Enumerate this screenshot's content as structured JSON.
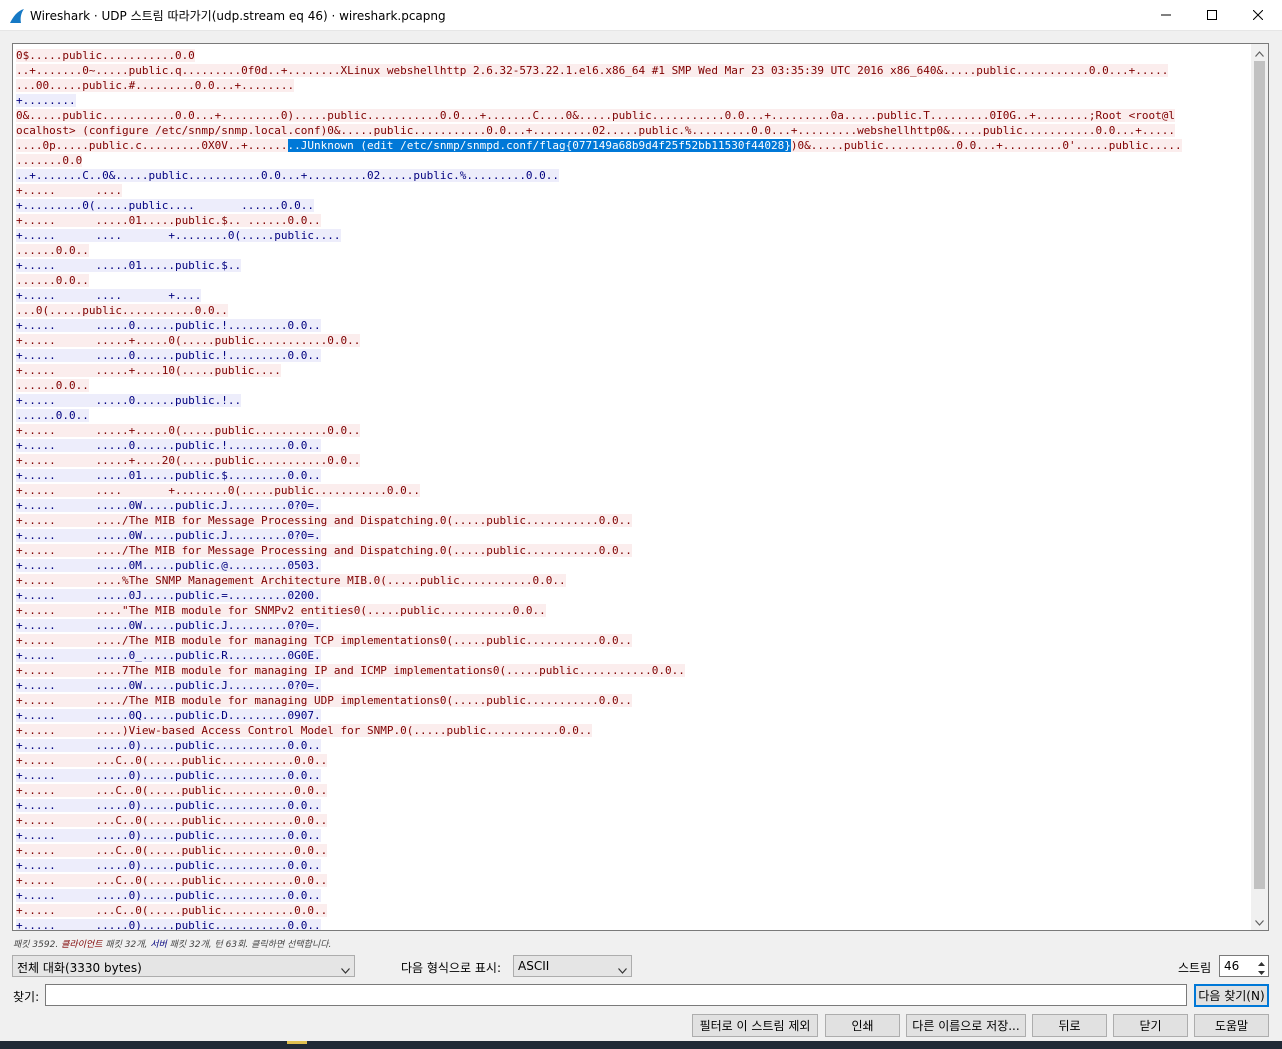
{
  "window": {
    "title": "Wireshark · UDP 스트림 따라가기(udp.stream eq 46) · wireshark.pcapng"
  },
  "stream": {
    "lines": [
      [
        [
          "c",
          "0$.....public...........0.0"
        ]
      ],
      [
        [
          "c",
          "..+.......0~.....public.q.........0f0d..+........XLinux webshellhttp 2.6.32-573.22.1.el6.x86_64 #1 SMP Wed Mar 23 03:35:39 UTC 2016 x86_640&.....public...........0.0...+....."
        ]
      ],
      [
        [
          "c",
          "...00.....public.#.........0.0...+........"
        ]
      ],
      [
        [
          "s",
          "+........"
        ]
      ],
      [
        [
          "c",
          "0&.....public...........0.0...+.........0).....public...........0.0...+.......C....0&.....public...........0.0...+.........0a.....public.T.........0I0G..+........;Root <root@l"
        ]
      ],
      [
        [
          "c",
          "ocalhost> (configure /etc/snmp/snmp.local.conf)0&.....public...........0.0...+.........02.....public.%.........0.0...+.........webshellhttp0&.....public...........0.0...+....."
        ]
      ],
      [
        [
          "c",
          "....0p.....public.c.........0X0V..+......"
        ],
        [
          "sel",
          "..JUnknown (edit /etc/snmp/snmpd.conf/flag{077149a68b9d4f25f52bb11530f44028}"
        ],
        [
          "c",
          ")0&.....public...........0.0...+.........0'.....public....."
        ]
      ],
      [
        [
          "c",
          ".......0.0"
        ]
      ],
      [
        [
          "s",
          "..+.......C..0&.....public...........0.0...+.........02.....public.%.........0.0.."
        ]
      ],
      [
        [
          "c",
          "+.....      ...."
        ]
      ],
      [
        [
          "s",
          "+.........0(.....public....       ......0.0.."
        ]
      ],
      [
        [
          "c",
          "+.....      .....01.....public.$.. ......0.0.."
        ]
      ],
      [
        [
          "s",
          "+.....      ....       +........0(.....public...."
        ]
      ],
      [
        [
          "c",
          "......0.0.."
        ]
      ],
      [
        [
          "s",
          "+.....      .....01.....public.$.."
        ]
      ],
      [
        [
          "c",
          "......0.0.."
        ]
      ],
      [
        [
          "s",
          "+.....      ....       +...."
        ]
      ],
      [
        [
          "c",
          "...0(.....public...........0.0.."
        ]
      ],
      [
        [
          "s",
          "+.....      .....0......public.!.........0.0.."
        ]
      ],
      [
        [
          "c",
          "+.....      .....+.....0(.....public...........0.0.."
        ]
      ],
      [
        [
          "s",
          "+.....      .....0......public.!.........0.0.."
        ]
      ],
      [
        [
          "c",
          "+.....      .....+....10(.....public...."
        ]
      ],
      [
        [
          "c",
          "......0.0.."
        ]
      ],
      [
        [
          "s",
          "+.....      .....0......public.!.."
        ]
      ],
      [
        [
          "s",
          "......0.0.."
        ]
      ],
      [
        [
          "c",
          "+.....      .....+.....0(.....public...........0.0.."
        ]
      ],
      [
        [
          "s",
          "+.....      .....0......public.!.........0.0.."
        ]
      ],
      [
        [
          "c",
          "+.....      .....+....20(.....public...........0.0.."
        ]
      ],
      [
        [
          "s",
          "+.....      .....01.....public.$.........0.0.."
        ]
      ],
      [
        [
          "c",
          "+.....      ....       +........0(.....public...........0.0.."
        ]
      ],
      [
        [
          "s",
          "+.....      .....0W.....public.J.........0?0=."
        ]
      ],
      [
        [
          "c",
          "+.....      ..../The MIB for Message Processing and Dispatching.0(.....public...........0.0.."
        ]
      ],
      [
        [
          "s",
          "+.....      .....0W.....public.J.........0?0=."
        ]
      ],
      [
        [
          "c",
          "+.....      ..../The MIB for Message Processing and Dispatching.0(.....public...........0.0.."
        ]
      ],
      [
        [
          "s",
          "+.....      .....0M.....public.@.........0503."
        ]
      ],
      [
        [
          "c",
          "+.....      ....%The SNMP Management Architecture MIB.0(.....public...........0.0.."
        ]
      ],
      [
        [
          "s",
          "+.....      .....0J.....public.=.........0200."
        ]
      ],
      [
        [
          "c",
          "+.....      ....\"The MIB module for SNMPv2 entities0(.....public...........0.0.."
        ]
      ],
      [
        [
          "s",
          "+.....      .....0W.....public.J.........0?0=."
        ]
      ],
      [
        [
          "c",
          "+.....      ..../The MIB module for managing TCP implementations0(.....public...........0.0.."
        ]
      ],
      [
        [
          "s",
          "+.....      .....0_.....public.R.........0G0E."
        ]
      ],
      [
        [
          "c",
          "+.....      ....7The MIB module for managing IP and ICMP implementations0(.....public...........0.0.."
        ]
      ],
      [
        [
          "s",
          "+.....      .....0W.....public.J.........0?0=."
        ]
      ],
      [
        [
          "c",
          "+.....      ..../The MIB module for managing UDP implementations0(.....public...........0.0.."
        ]
      ],
      [
        [
          "s",
          "+.....      .....0Q.....public.D.........0907."
        ]
      ],
      [
        [
          "c",
          "+.....      ....)View-based Access Control Model for SNMP.0(.....public...........0.0.."
        ]
      ],
      [
        [
          "s",
          "+.....      .....0).....public...........0.0.."
        ]
      ],
      [
        [
          "c",
          "+.....      ...C..0(.....public...........0.0.."
        ]
      ],
      [
        [
          "s",
          "+.....      .....0).....public...........0.0.."
        ]
      ],
      [
        [
          "c",
          "+.....      ...C..0(.....public...........0.0.."
        ]
      ],
      [
        [
          "s",
          "+.....      .....0).....public...........0.0.."
        ]
      ],
      [
        [
          "c",
          "+.....      ...C..0(.....public...........0.0.."
        ]
      ],
      [
        [
          "s",
          "+.....      .....0).....public...........0.0.."
        ]
      ],
      [
        [
          "c",
          "+.....      ...C..0(.....public...........0.0.."
        ]
      ],
      [
        [
          "s",
          "+.....      .....0).....public...........0.0.."
        ]
      ],
      [
        [
          "c",
          "+.....      ...C..0(.....public...........0.0.."
        ]
      ],
      [
        [
          "s",
          "+.....      .....0).....public...........0.0.."
        ]
      ],
      [
        [
          "c",
          "+.....      ...C..0(.....public...........0.0.."
        ]
      ],
      [
        [
          "s",
          "+.....      .....0).....public...........0.0.."
        ]
      ]
    ]
  },
  "status": {
    "prefix": "패킷 3592. ",
    "client": "클라이언트",
    "mid1": " 패킷 32개, ",
    "server": "서버",
    "suffix": " 패킷 32개, 턴 63회. 클릭하면 선택합니다."
  },
  "controls": {
    "conversation": "전체 대화(3330 bytes)",
    "format_label": "다음 형식으로 표시:",
    "format_value": "ASCII",
    "stream_label": "스트림",
    "stream_value": "46",
    "find_label": "찾기:",
    "find_value": "",
    "find_next": "다음 찾기(N)"
  },
  "buttons": {
    "filter_out": "필터로 이 스트림 제외",
    "print": "인쇄",
    "save_as": "다른 이름으로 저장...",
    "back": "뒤로",
    "close": "닫기",
    "help": "도움말"
  },
  "icons": {
    "app": "wireshark-fin-icon",
    "minimize": "minimize-icon",
    "maximize": "maximize-icon",
    "close": "close-icon"
  }
}
